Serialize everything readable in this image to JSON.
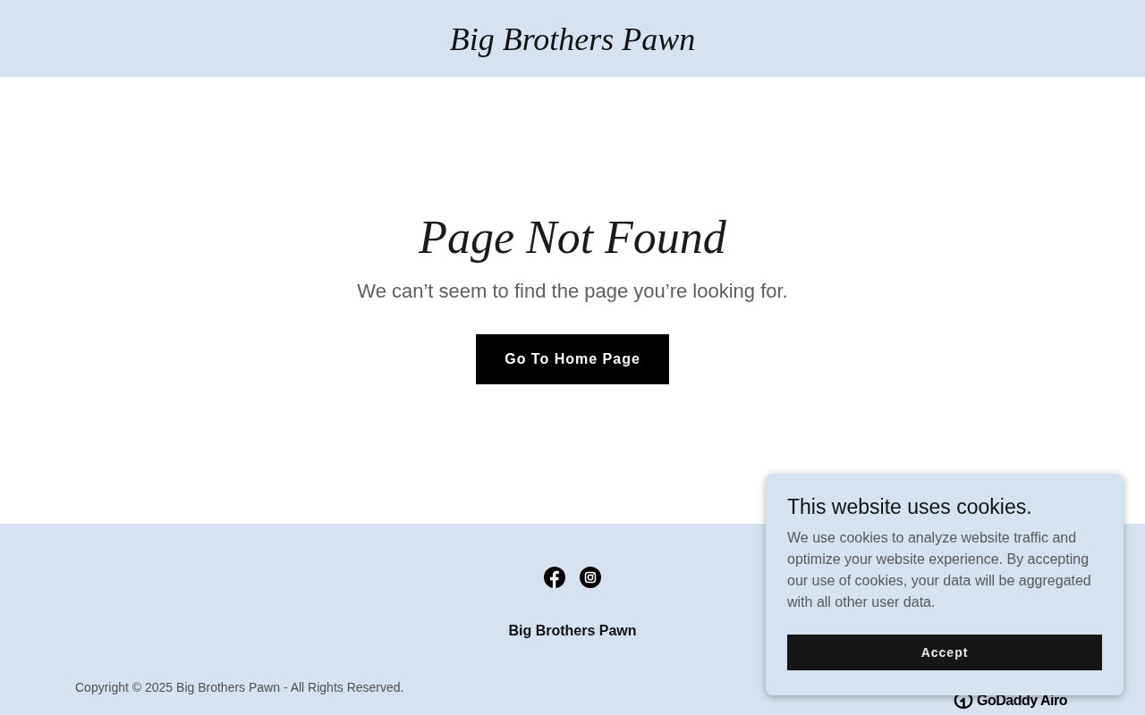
{
  "header": {
    "site_title": "Big Brothers Pawn"
  },
  "main": {
    "heading": "Page Not Found",
    "message": "We can’t seem to find the page you’re looking for.",
    "button": "Go To Home Page"
  },
  "footer": {
    "business_name": "Big Brothers Pawn",
    "copyright": "Copyright © 2025 Big Brothers Pawn - All Rights Reserved.",
    "powered_by": "GoDaddy Airo"
  },
  "cookie_banner": {
    "title": "This website uses cookies.",
    "text": "We use cookies to analyze website traffic and optimize your website experience. By accepting our use of cookies, your data will be aggregated with all other user data.",
    "button": "Accept"
  }
}
